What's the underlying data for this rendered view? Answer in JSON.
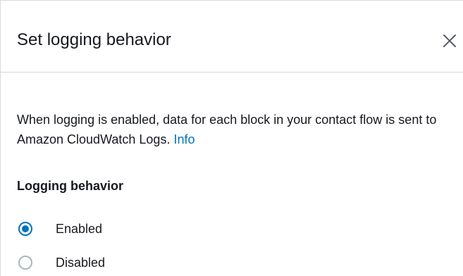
{
  "dialog": {
    "title": "Set logging behavior",
    "close_icon": "close-icon",
    "description_text": "When logging is enabled, data for each block in your contact flow is sent to Amazon CloudWatch Logs.",
    "info_link": "Info",
    "section_label": "Logging behavior",
    "options": [
      {
        "label": "Enabled",
        "selected": true
      },
      {
        "label": "Disabled",
        "selected": false
      }
    ]
  },
  "colors": {
    "accent": "#0073bb",
    "text": "#16191f",
    "border": "#d5dbdb",
    "radio_unchecked_border": "#aab7b8"
  }
}
